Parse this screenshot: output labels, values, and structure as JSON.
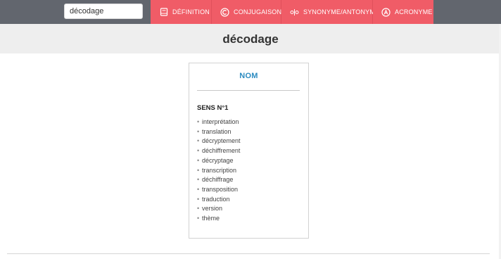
{
  "search": {
    "value": "décodage",
    "icon": "text-input"
  },
  "nav": {
    "items": [
      {
        "label": "DÉFINITION",
        "icon": "book-icon"
      },
      {
        "label": "CONJUGAISON",
        "icon": "copyright-c-icon"
      },
      {
        "label": "SYNONYME/ANTONYME",
        "icon": "opposite-arrows-icon"
      },
      {
        "label": "ACRONYME",
        "icon": "circled-a-icon"
      }
    ]
  },
  "page": {
    "title": "décodage"
  },
  "card": {
    "category": "NOM",
    "sense_title": "SENS N°1",
    "synonyms": [
      "interprétation",
      "translation",
      "décryptement",
      "déchiffrement",
      "décryptage",
      "transcription",
      "déchiffrage",
      "transposition",
      "traduction",
      "version",
      "thème"
    ]
  },
  "colors": {
    "topbar": "#62666e",
    "nav_accent": "#f05c67",
    "category_blue": "#2b8bc0",
    "titlebar_bg": "#eeeeee"
  }
}
